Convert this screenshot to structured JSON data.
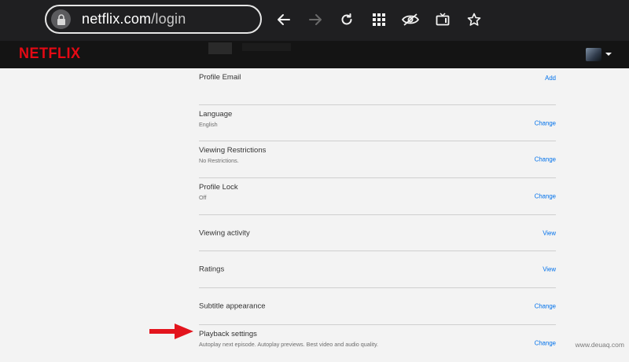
{
  "browser": {
    "url_host": "netflix.com",
    "url_path": "/login",
    "icons": [
      "lock-icon",
      "back-icon",
      "forward-icon",
      "reload-icon",
      "grid-icon",
      "eye-off-icon",
      "tv-icon",
      "star-icon"
    ]
  },
  "header": {
    "logo": "NETFLIX",
    "brand_color": "#e50914"
  },
  "settings": [
    {
      "title": "Profile Email",
      "sub": "",
      "action": "Add"
    },
    {
      "title": "Language",
      "sub": "English",
      "action": "Change"
    },
    {
      "title": "Viewing Restrictions",
      "sub": "No Restrictions.",
      "action": "Change"
    },
    {
      "title": "Profile Lock",
      "sub": "Off",
      "action": "Change"
    },
    {
      "title": "Viewing activity",
      "sub": "",
      "action": "View"
    },
    {
      "title": "Ratings",
      "sub": "",
      "action": "View"
    },
    {
      "title": "Subtitle appearance",
      "sub": "",
      "action": "Change"
    },
    {
      "title": "Playback settings",
      "sub": "Autoplay next episode. Autoplay previews. Best video and audio quality.",
      "action": "Change"
    }
  ],
  "watermark": "www.deuaq.com",
  "colors": {
    "link": "#0071eb",
    "arrow": "#e3141d"
  }
}
